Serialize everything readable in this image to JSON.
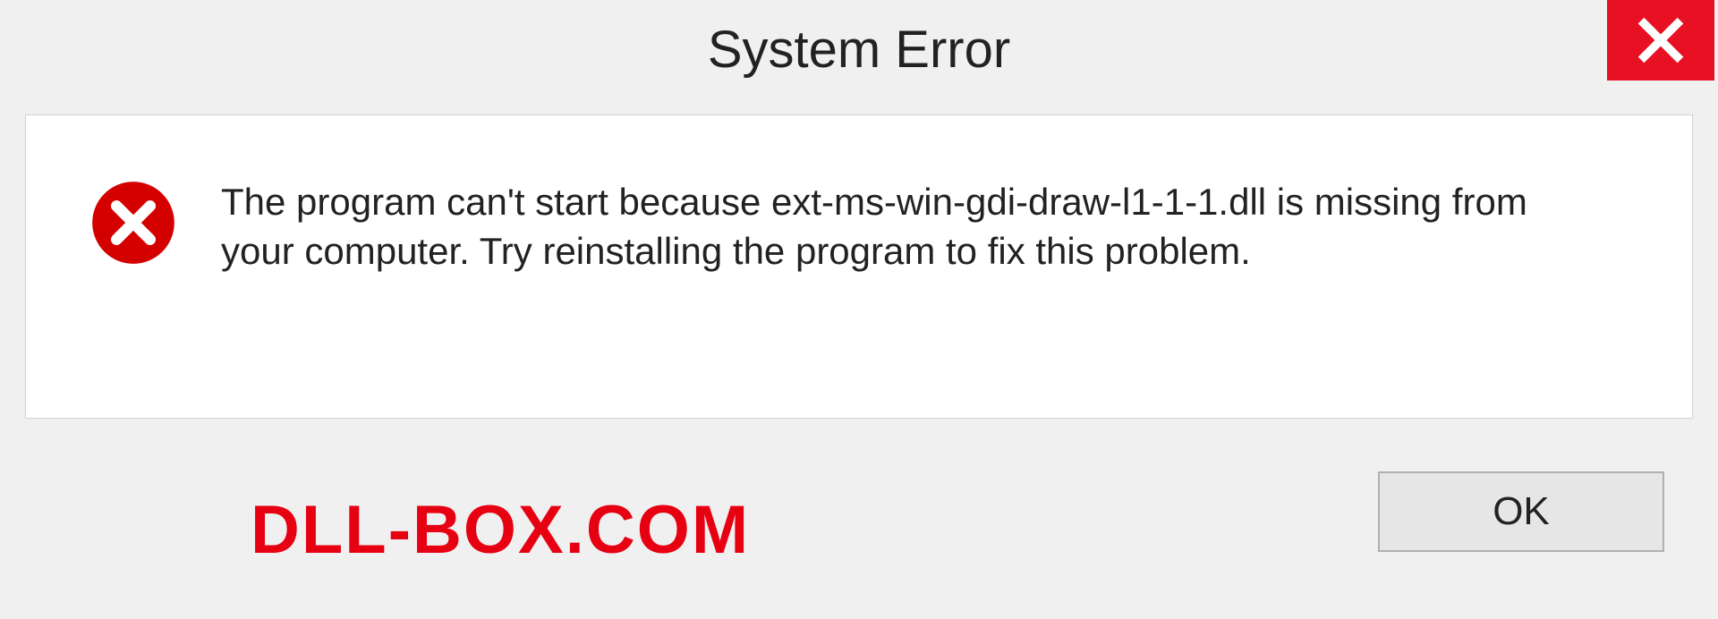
{
  "dialog": {
    "title": "System Error",
    "message": "The program can't start because ext-ms-win-gdi-draw-l1-1-1.dll is missing from your computer. Try reinstalling the program to fix this problem.",
    "ok_label": "OK"
  },
  "watermark": "DLL-BOX.COM",
  "colors": {
    "close_bg": "#e81123",
    "error_icon": "#d40000",
    "watermark": "#e60012"
  }
}
